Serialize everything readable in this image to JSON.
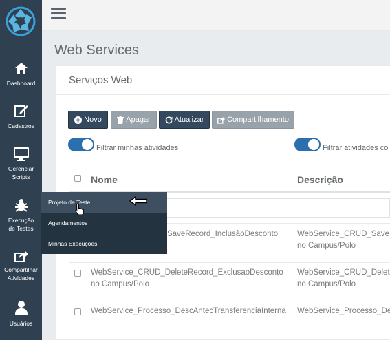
{
  "sidebar": {
    "logo_icon": "aperture-logo-icon",
    "items": [
      {
        "label": "Dashboard",
        "icon": "home-icon"
      },
      {
        "label": "Cadastros",
        "icon": "edit-icon"
      },
      {
        "label_line1": "Gerenciar",
        "label_line2": "Scripts",
        "icon": "monitor-icon"
      },
      {
        "label_line1": "Execução",
        "label_line2": "de Testes",
        "icon": "bug-icon"
      },
      {
        "label_line1": "Compartilhar",
        "label_line2": "Atividades",
        "icon": "share-icon"
      },
      {
        "label": "Usuários",
        "icon": "user-icon"
      }
    ]
  },
  "page": {
    "title": "Web Services"
  },
  "panel": {
    "title": "Serviços Web"
  },
  "toolbar": {
    "novo": "Novo",
    "apagar": "Apagar",
    "atualizar": "Atualizar",
    "compartilhamento": "Compartilhamento"
  },
  "filters": {
    "minhas": "Filtrar minhas atividades",
    "atividades": "Filtrar atividades co"
  },
  "table": {
    "headers": {
      "nome": "Nome",
      "descricao": "Descrição"
    },
    "rows": [
      {
        "nome_line1": "SaveRecord_InclusãoDesconto",
        "nome_line2": "",
        "desc_line1": "WebService_CRUD_Save",
        "desc_line2": "no Campus/Polo"
      },
      {
        "nome_line1": "WebService_CRUD_DeleteRecord_ExclusaoDesconto",
        "nome_line2": "no Campus/Polo",
        "desc_line1": "WebService_CRUD_Delet",
        "desc_line2": "no Campus/Polo"
      },
      {
        "nome_line1": "WebService_Processo_DescAntecTransferenciaInterna",
        "nome_line2": "",
        "desc_line1": "WebService_Processo_De",
        "desc_line2": ""
      }
    ]
  },
  "submenu": {
    "items": [
      {
        "label": "Projeto de Teste"
      },
      {
        "label": "Agendamentos"
      },
      {
        "label": "Minhas Execuções"
      }
    ]
  },
  "colors": {
    "sidebar": "#2f4050",
    "submenu": "#243340",
    "button_dark": "#34495e",
    "button_gray": "#97a2ab",
    "toggle": "#2c6fae"
  }
}
